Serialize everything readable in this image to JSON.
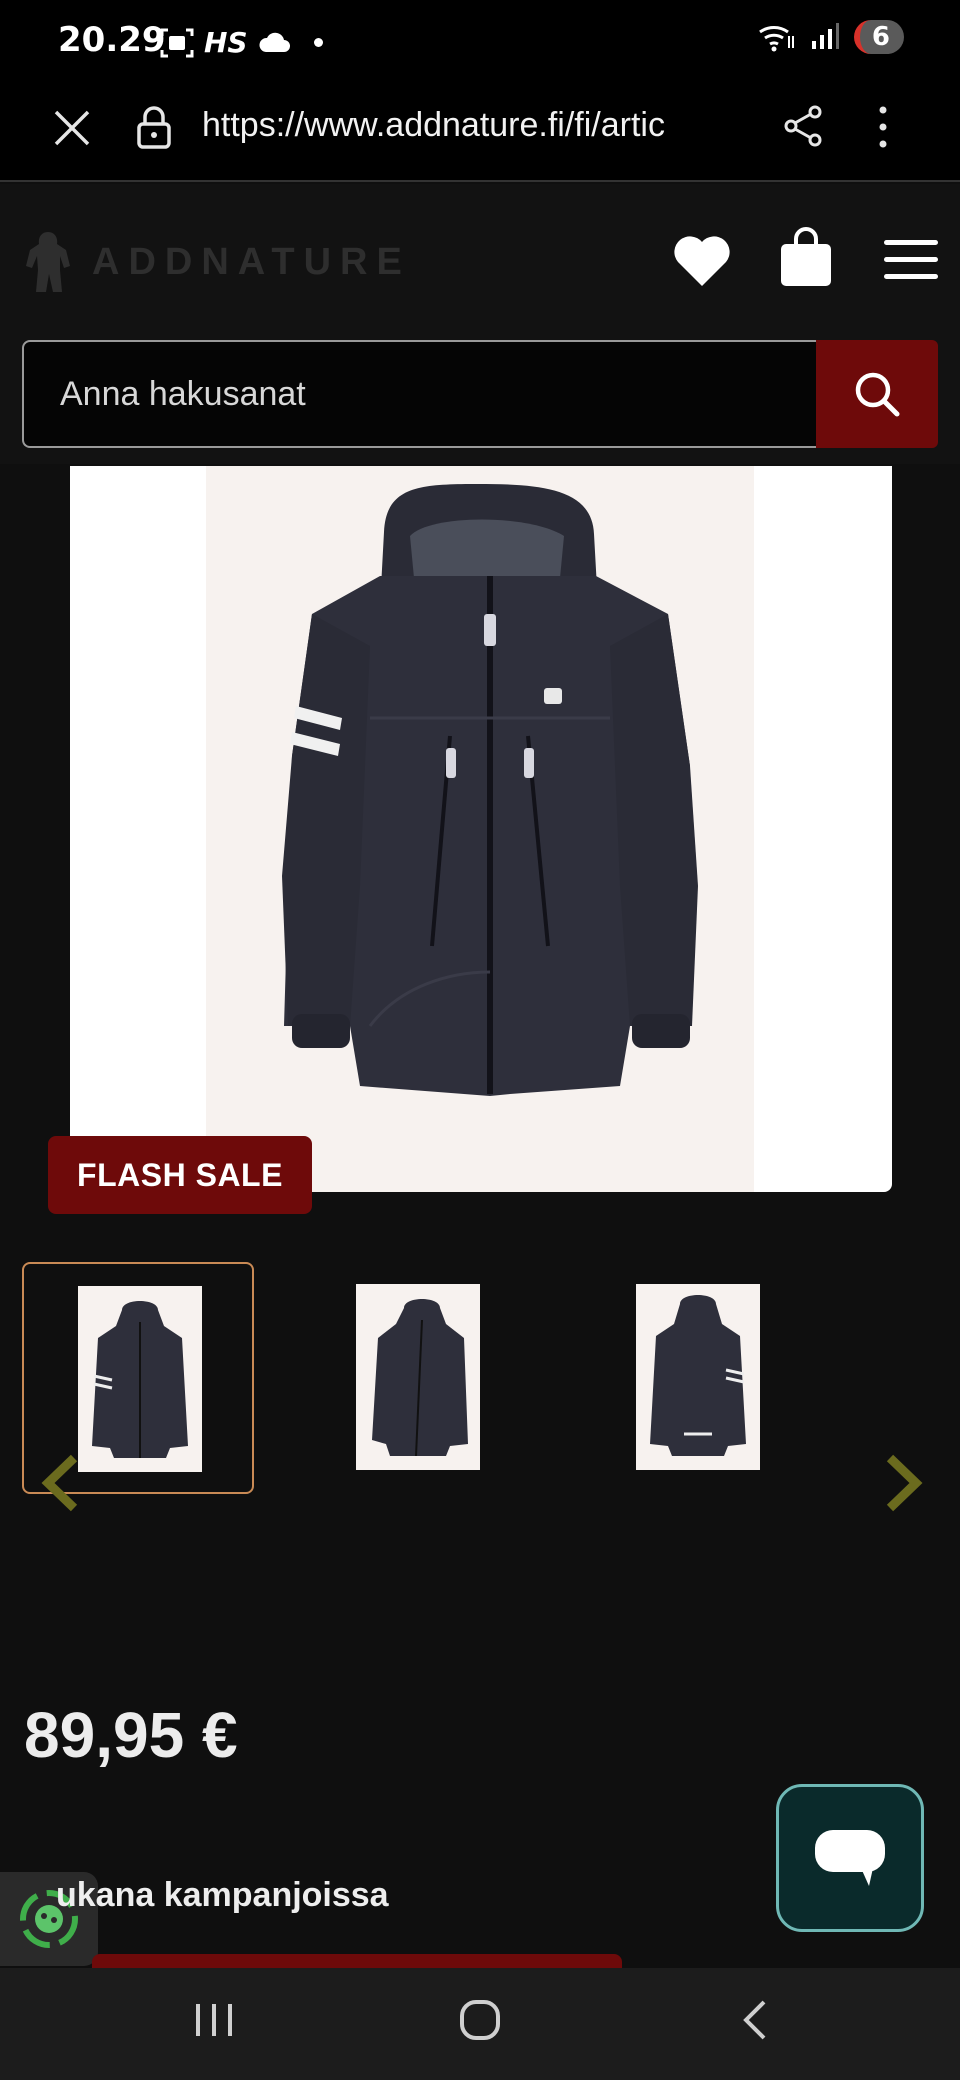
{
  "status_bar": {
    "time": "20.29",
    "hs_label": "HS",
    "battery_level": "6"
  },
  "browser": {
    "url": "https://www.addnature.fi/fi/artic"
  },
  "header": {
    "logo_text": "ADDNATURE",
    "search_placeholder": "Anna hakusanat"
  },
  "product": {
    "badge": "FLASH SALE",
    "price": "89,95 €",
    "thumbnails": [
      "front",
      "side",
      "back"
    ],
    "selected_thumbnail": 0
  },
  "promo": {
    "text": "ukana kampanjoissa"
  },
  "colors": {
    "accent": "#6e0a0a",
    "selected_border": "#c98a55",
    "arrow": "#6b6b1e",
    "chat_border": "#6fb8b5",
    "jacket": "#2e2f3b"
  }
}
